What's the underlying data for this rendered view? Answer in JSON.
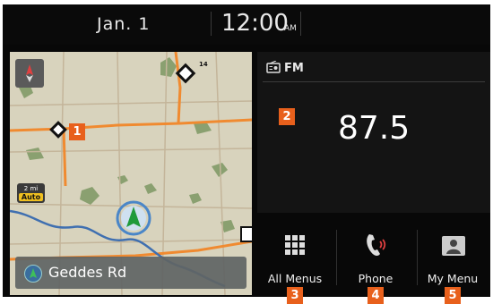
{
  "status_bar": {
    "date": "Jan. 1",
    "time": "12:00",
    "ampm": "AM"
  },
  "map": {
    "compass_label": "N",
    "scale": {
      "distance": "2 mi",
      "mode": "Auto"
    },
    "route_shield_label": "14",
    "road_name": "Geddes Rd",
    "colors": {
      "land": "#d8d3bd",
      "water": "#3f6fb0",
      "road": "#f08a30",
      "park": "#8aa070"
    }
  },
  "radio": {
    "band": "FM",
    "frequency": "87.5"
  },
  "dock": {
    "items": [
      {
        "label": "All Menus",
        "icon": "grid-icon"
      },
      {
        "label": "Phone",
        "icon": "phone-icon"
      },
      {
        "label": "My Menu",
        "icon": "person-icon"
      }
    ]
  },
  "callouts": [
    "1",
    "2",
    "3",
    "4",
    "5"
  ],
  "colors": {
    "callout": "#e8601c",
    "screen_bg": "#080808"
  }
}
